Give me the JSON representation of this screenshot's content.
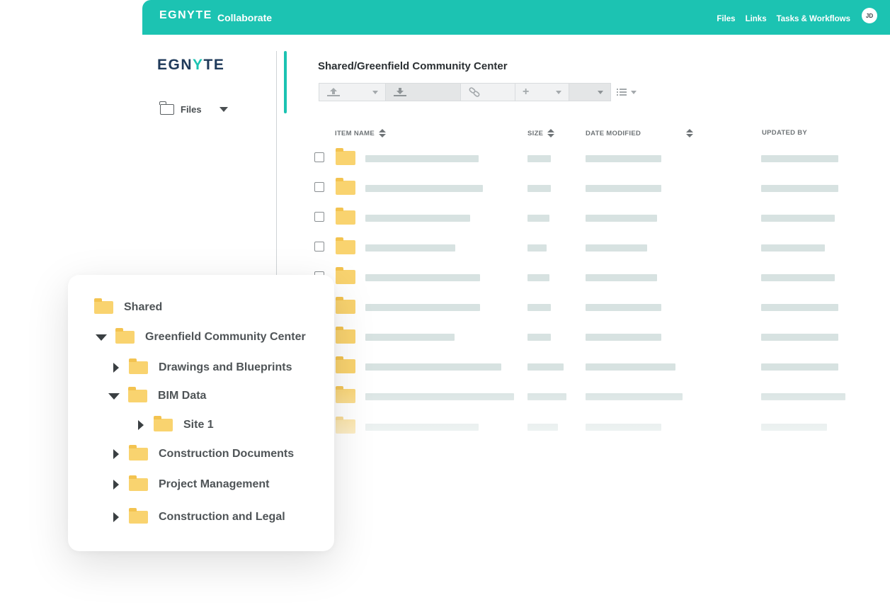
{
  "header": {
    "logo_text": "EGNYTE",
    "product_name": "Collaborate",
    "nav": [
      "Files",
      "Links",
      "Tasks & Workflows"
    ],
    "avatar_initials": "JD"
  },
  "sidebar": {
    "logo_left": "EGN",
    "logo_accent": "Y",
    "logo_right": "TE",
    "files_label": "Files"
  },
  "breadcrumb": "Shared/Greenfield Community Center",
  "table": {
    "columns": [
      "ITEM NAME",
      "SIZE",
      "DATE MODIFIED",
      "UPDATED BY"
    ],
    "row_count": 10
  },
  "tree": {
    "root": "Shared",
    "items": [
      {
        "label": "Greenfield Community Center",
        "expanded": true
      },
      {
        "label": "Drawings and Blueprints",
        "expanded": false
      },
      {
        "label": "BIM Data",
        "expanded": true
      },
      {
        "label": "Site 1",
        "expanded": false
      },
      {
        "label": "Construction Documents",
        "expanded": false
      },
      {
        "label": "Project Management",
        "expanded": false
      },
      {
        "label": "Construction and Legal",
        "expanded": false
      }
    ]
  },
  "colors": {
    "accent": "#1cc3b2",
    "folder": "#f9d36f",
    "placeholder_bar": "#d7e2e1"
  }
}
